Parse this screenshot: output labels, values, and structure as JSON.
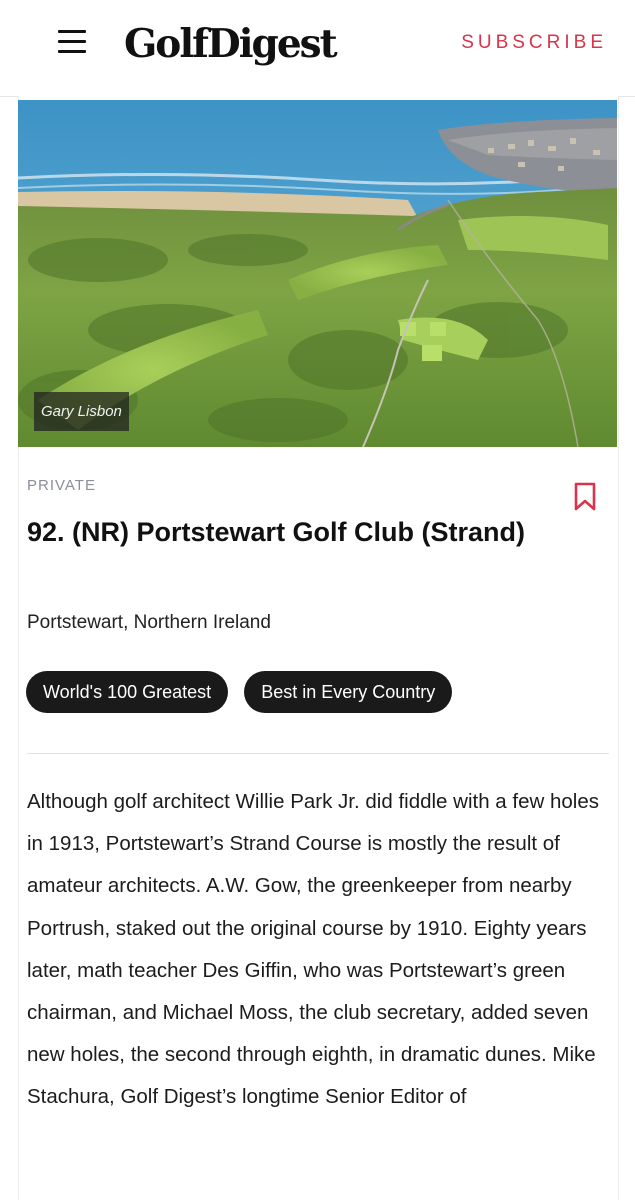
{
  "header": {
    "menu_icon": "hamburger-menu-icon",
    "logo_text": "GolfDigest",
    "subscribe_label": "SUBSCRIBE",
    "subscribe_color": "#d9344c"
  },
  "hero": {
    "photo_credit": "Gary Lisbon"
  },
  "course": {
    "category": "PRIVATE",
    "title": "92. (NR) Portstewart Golf Club (Strand)",
    "location": "Portstewart, Northern Ireland",
    "bookmark_icon": "bookmark-icon",
    "bookmark_color": "#d9344c",
    "tags": [
      "World's 100 Greatest",
      "Best in Every Country"
    ],
    "description": "Although golf architect Willie Park Jr. did fiddle with a few holes in 1913, Portstewart’s Strand Course is mostly the result of amateur architects. A.W. Gow, the greenkeeper from nearby Portrush, staked out the original course by 1910. Eighty years later, math teacher Des Giffin, who was Portstewart’s green chairman, and Michael Moss, the club secretary, added seven new holes, the second through eighth, in dramatic dunes. Mike Stachura, Golf Digest’s longtime Senior Editor of"
  }
}
